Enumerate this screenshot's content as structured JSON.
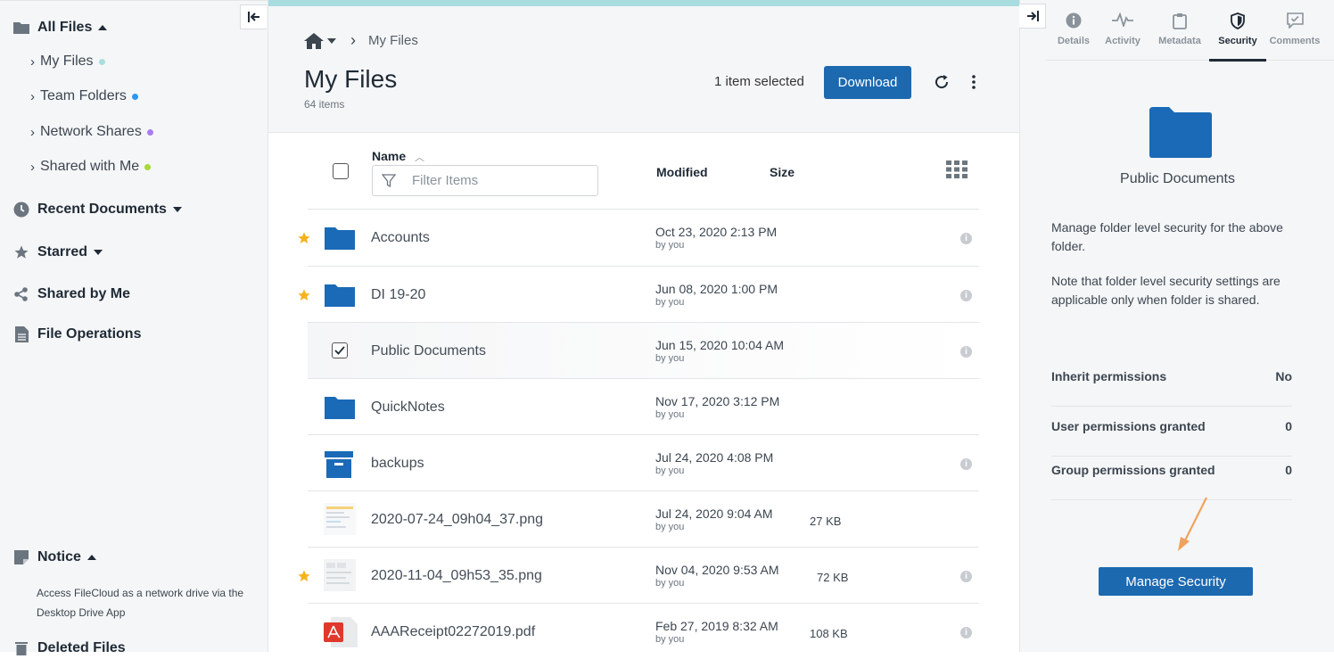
{
  "sidebar": {
    "all_files": "All Files",
    "sub_items": [
      {
        "label": "My Files",
        "dot": "#a8e0df"
      },
      {
        "label": "Team Folders",
        "dot": "#2b97f3"
      },
      {
        "label": "Network Shares",
        "dot": "#a97cf0"
      },
      {
        "label": "Shared with Me",
        "dot": "#a7d83a"
      }
    ],
    "recent": "Recent Documents",
    "starred": "Starred",
    "shared_by_me": "Shared by Me",
    "file_operations": "File Operations",
    "notice": "Notice",
    "notice_text": "Access FileCloud as a network drive via the Desktop Drive App",
    "deleted": "Deleted Files"
  },
  "main": {
    "breadcrumb": "My Files",
    "title": "My Files",
    "item_count": "64 items",
    "selection": "1 item selected",
    "download": "Download",
    "columns": {
      "name": "Name",
      "modified": "Modified",
      "size": "Size"
    },
    "filter_placeholder": "Filter Items",
    "rows": [
      {
        "name": "Accounts",
        "modified": "Oct 23, 2020 2:13 PM",
        "by": "by you",
        "size": ""
      },
      {
        "name": "DI 19-20",
        "modified": "Jun 08, 2020 1:00 PM",
        "by": "by you",
        "size": ""
      },
      {
        "name": "Public Documents",
        "modified": "Jun 15, 2020 10:04 AM",
        "by": "by you",
        "size": ""
      },
      {
        "name": "QuickNotes",
        "modified": "Nov 17, 2020 3:12 PM",
        "by": "by you",
        "size": ""
      },
      {
        "name": "backups",
        "modified": "Jul 24, 2020 4:08 PM",
        "by": "by you",
        "size": ""
      },
      {
        "name": "2020-07-24_09h04_37.png",
        "modified": "Jul 24, 2020 9:04 AM",
        "by": "by you",
        "size": "27 KB"
      },
      {
        "name": "2020-11-04_09h53_35.png",
        "modified": "Nov 04, 2020 9:53 AM",
        "by": "by you",
        "size": "72 KB"
      },
      {
        "name": "AAAReceipt02272019.pdf",
        "modified": "Feb 27, 2019 8:32 AM",
        "by": "by you",
        "size": "108 KB"
      }
    ]
  },
  "panel": {
    "tabs": [
      "Details",
      "Activity",
      "Metadata",
      "Security",
      "Comments"
    ],
    "active_tab": "Security",
    "folder_name": "Public Documents",
    "desc1": "Manage folder level security for the above folder.",
    "desc2": "Note that folder level security settings are applicable only when folder is shared.",
    "permissions": [
      {
        "label": "Inherit permissions",
        "value": "No"
      },
      {
        "label": "User permissions granted",
        "value": "0"
      },
      {
        "label": "Group permissions granted",
        "value": "0"
      }
    ],
    "manage_button": "Manage Security"
  },
  "colors": {
    "accent": "#1c69b0",
    "folder": "#1a6ab7",
    "star": "#f5b21b",
    "progress": "#a8dde0",
    "annotation_arrow": "#f0a35e"
  }
}
